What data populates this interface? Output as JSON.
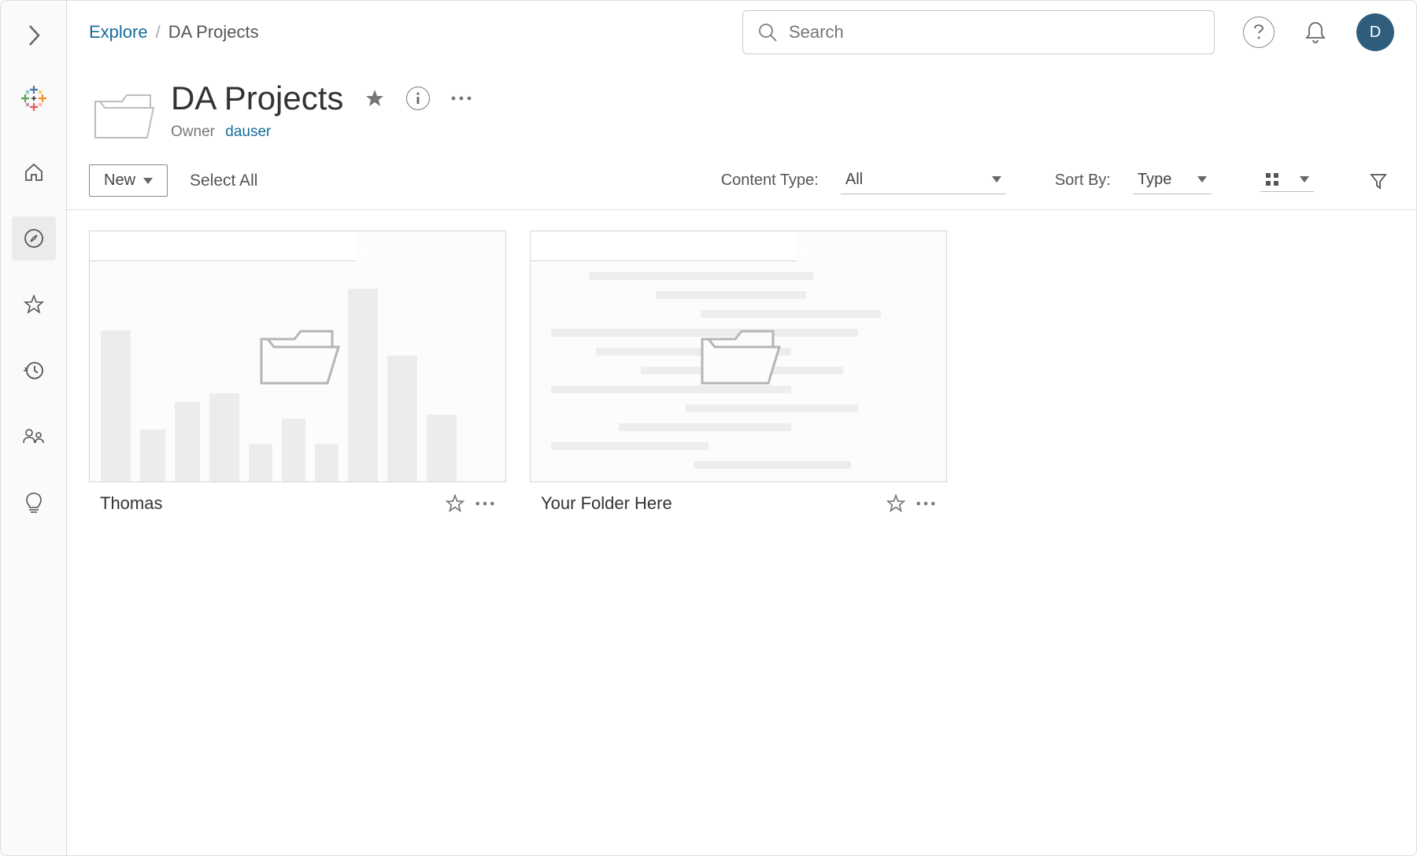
{
  "breadcrumb": {
    "root": "Explore",
    "current": "DA Projects"
  },
  "search": {
    "placeholder": "Search"
  },
  "avatar": {
    "initial": "D"
  },
  "project": {
    "title": "DA Projects",
    "owner_label": "Owner",
    "owner_name": "dauser"
  },
  "toolbar": {
    "new_label": "New",
    "select_all": "Select All",
    "content_type_label": "Content Type:",
    "content_type_value": "All",
    "sort_by_label": "Sort By:",
    "sort_by_value": "Type"
  },
  "cards": [
    {
      "title": "Thomas"
    },
    {
      "title": "Your Folder Here"
    }
  ]
}
